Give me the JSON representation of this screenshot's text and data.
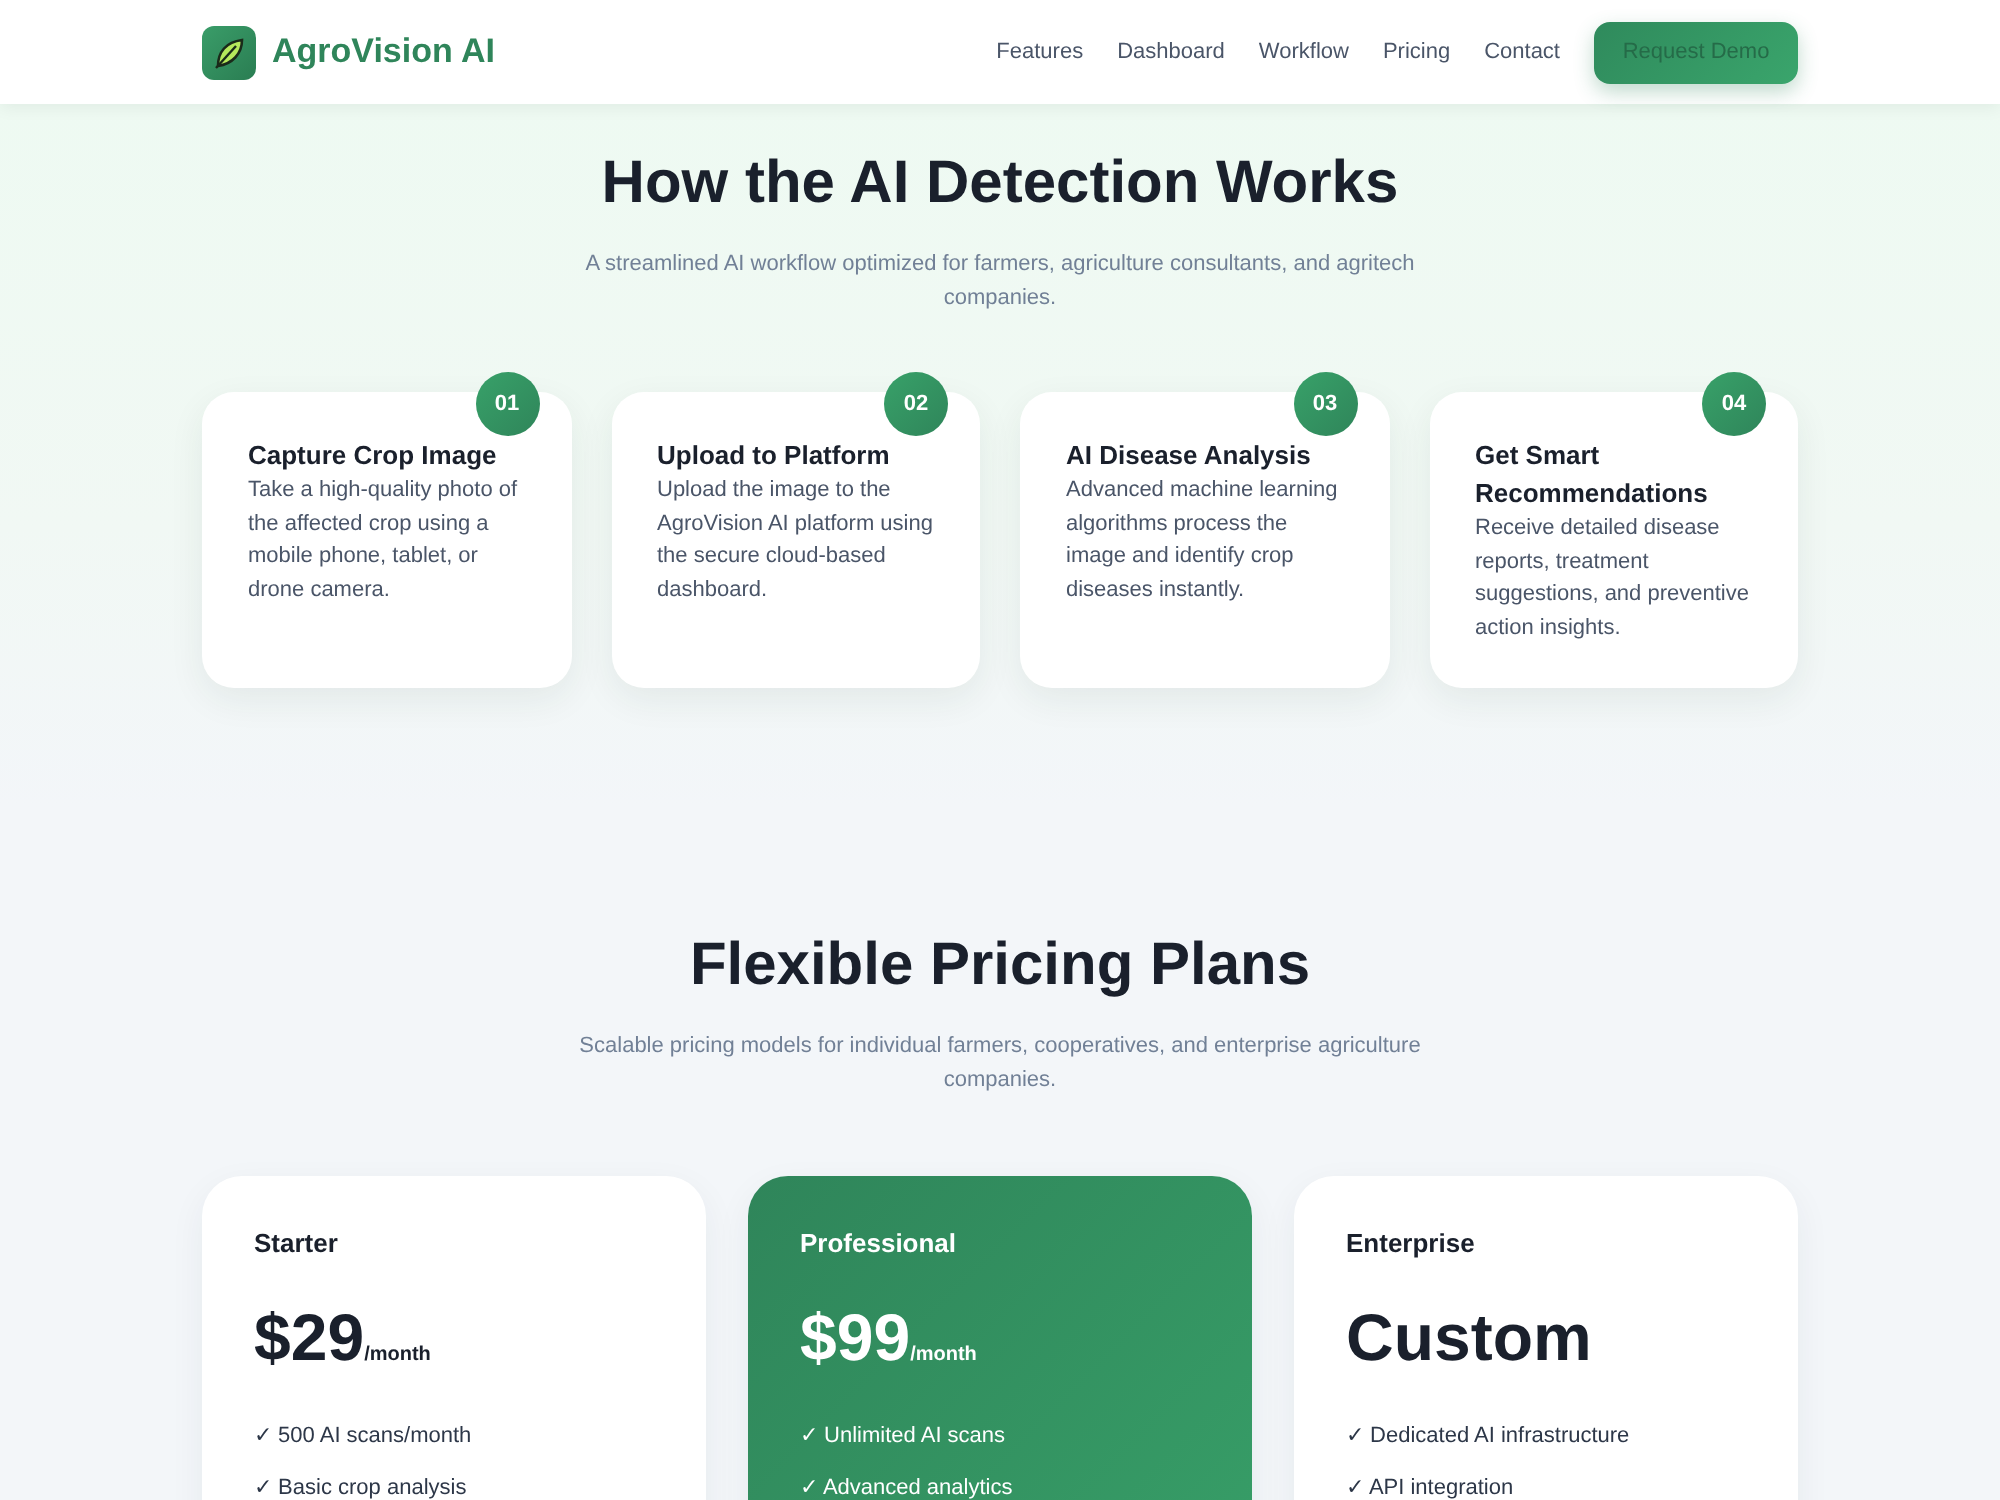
{
  "header": {
    "brand": "AgroVision AI",
    "nav": [
      {
        "label": "Features"
      },
      {
        "label": "Dashboard"
      },
      {
        "label": "Workflow"
      },
      {
        "label": "Pricing"
      },
      {
        "label": "Contact"
      }
    ],
    "cta": "Request Demo"
  },
  "workflow": {
    "title": "How the AI Detection Works",
    "subtitle": "A streamlined AI workflow optimized for farmers, agriculture consultants, and agritech companies.",
    "steps": [
      {
        "number": "01",
        "title": "Capture Crop Image",
        "description": "Take a high-quality photo of the affected crop using a mobile phone, tablet, or drone camera."
      },
      {
        "number": "02",
        "title": "Upload to Platform",
        "description": "Upload the image to the AgroVision AI platform using the secure cloud-based dashboard."
      },
      {
        "number": "03",
        "title": "AI Disease Analysis",
        "description": "Advanced machine learning algorithms process the image and identify crop diseases instantly."
      },
      {
        "number": "04",
        "title": "Get Smart Recommendations",
        "description": "Receive detailed disease reports, treatment suggestions, and preventive action insights."
      }
    ]
  },
  "pricing": {
    "title": "Flexible Pricing Plans",
    "subtitle": "Scalable pricing models for individual farmers, cooperatives, and enterprise agriculture companies.",
    "plans": [
      {
        "name": "Starter",
        "price": "$29",
        "period": "/month",
        "featured": false,
        "features": [
          "✓ 500 AI scans/month",
          "✓ Basic crop analysis"
        ]
      },
      {
        "name": "Professional",
        "price": "$99",
        "period": "/month",
        "featured": true,
        "features": [
          "✓ Unlimited AI scans",
          "✓ Advanced analytics"
        ]
      },
      {
        "name": "Enterprise",
        "price": "Custom",
        "featured": false,
        "features": [
          "✓ Dedicated AI infrastructure",
          "✓ API integration"
        ]
      }
    ]
  }
}
